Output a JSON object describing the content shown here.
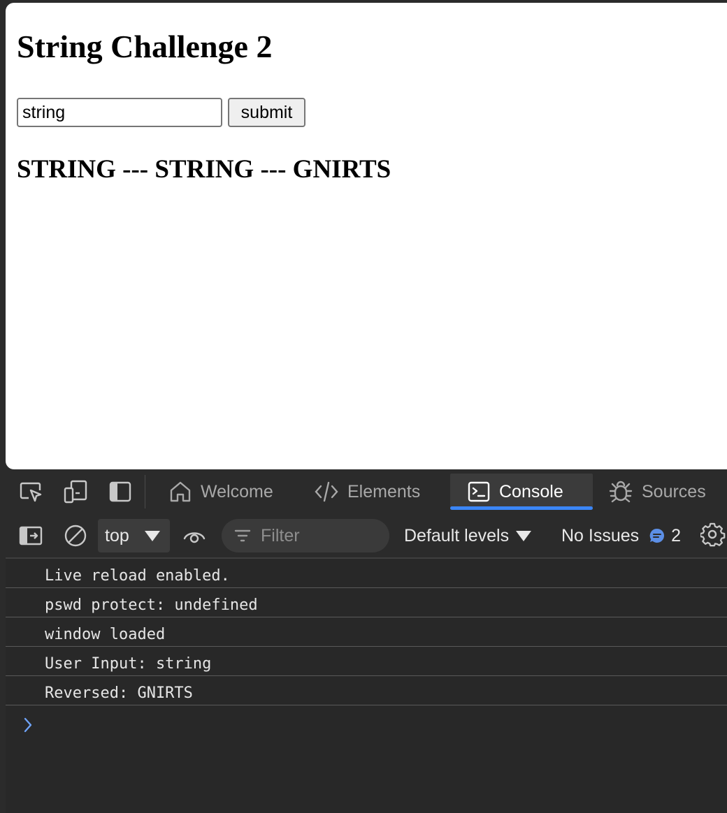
{
  "page": {
    "title": "String Challenge 2",
    "input_value": "string",
    "submit_label": "submit",
    "result_text": "STRING --- STRING --- GNIRTS"
  },
  "devtools": {
    "tabs": [
      {
        "label": "Welcome",
        "icon": "home-icon",
        "active": false
      },
      {
        "label": "Elements",
        "icon": "code-icon",
        "active": false
      },
      {
        "label": "Console",
        "icon": "console-icon",
        "active": true
      },
      {
        "label": "Sources",
        "icon": "bug-icon",
        "active": false
      }
    ],
    "toolbar": {
      "context": "top",
      "filter_placeholder": "Filter",
      "levels_label": "Default levels",
      "issues_label": "No Issues",
      "message_count": "2"
    },
    "console_lines": [
      "Live reload enabled.",
      "pswd protect: undefined",
      "window loaded",
      "User Input: string",
      "Reversed: GNIRTS"
    ],
    "colors": {
      "panel_bg": "#2b2b2b",
      "active_tab_underline": "#3b86f7",
      "prompt": "#6fa3f7"
    }
  }
}
